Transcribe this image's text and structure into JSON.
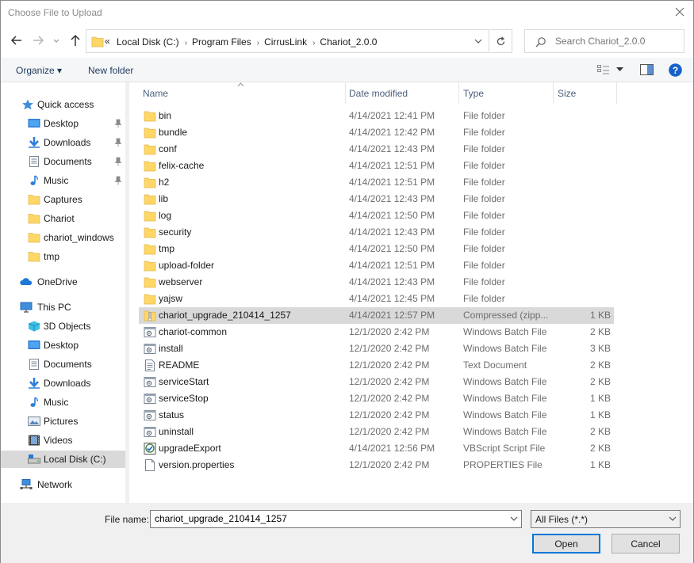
{
  "window": {
    "title": "Choose File to Upload"
  },
  "address": {
    "overflow": "«",
    "crumbs": [
      "Local Disk (C:)",
      "Program Files",
      "CirrusLink",
      "Chariot_2.0.0"
    ]
  },
  "search": {
    "placeholder": "Search Chariot_2.0.0"
  },
  "toolbar": {
    "organize": "Organize ▾",
    "new_folder": "New folder",
    "help": "?"
  },
  "nav": {
    "quick_access": "Quick access",
    "quick_items": [
      {
        "label": "Desktop",
        "icon": "desktop-icon",
        "pinned": true
      },
      {
        "label": "Downloads",
        "icon": "downloads-icon",
        "pinned": true
      },
      {
        "label": "Documents",
        "icon": "documents-icon",
        "pinned": true
      },
      {
        "label": "Music",
        "icon": "music-icon",
        "pinned": true
      },
      {
        "label": "Captures",
        "icon": "folder-icon",
        "pinned": false
      },
      {
        "label": "Chariot",
        "icon": "folder-icon",
        "pinned": false
      },
      {
        "label": "chariot_windows",
        "icon": "folder-icon",
        "pinned": false
      },
      {
        "label": "tmp",
        "icon": "folder-icon",
        "pinned": false
      }
    ],
    "onedrive": "OneDrive",
    "this_pc": "This PC",
    "pc_items": [
      {
        "label": "3D Objects",
        "icon": "3d-objects-icon"
      },
      {
        "label": "Desktop",
        "icon": "desktop-icon"
      },
      {
        "label": "Documents",
        "icon": "documents-icon"
      },
      {
        "label": "Downloads",
        "icon": "downloads-icon"
      },
      {
        "label": "Music",
        "icon": "music-icon"
      },
      {
        "label": "Pictures",
        "icon": "pictures-icon"
      },
      {
        "label": "Videos",
        "icon": "videos-icon"
      },
      {
        "label": "Local Disk (C:)",
        "icon": "drive-icon"
      }
    ],
    "network": "Network"
  },
  "columns": {
    "name": "Name",
    "date": "Date modified",
    "type": "Type",
    "size": "Size"
  },
  "files": [
    {
      "name": "bin",
      "date": "4/14/2021 12:41 PM",
      "type": "File folder",
      "size": "",
      "icon": "folder-icon"
    },
    {
      "name": "bundle",
      "date": "4/14/2021 12:42 PM",
      "type": "File folder",
      "size": "",
      "icon": "folder-icon"
    },
    {
      "name": "conf",
      "date": "4/14/2021 12:43 PM",
      "type": "File folder",
      "size": "",
      "icon": "folder-icon"
    },
    {
      "name": "felix-cache",
      "date": "4/14/2021 12:51 PM",
      "type": "File folder",
      "size": "",
      "icon": "folder-icon"
    },
    {
      "name": "h2",
      "date": "4/14/2021 12:51 PM",
      "type": "File folder",
      "size": "",
      "icon": "folder-icon"
    },
    {
      "name": "lib",
      "date": "4/14/2021 12:43 PM",
      "type": "File folder",
      "size": "",
      "icon": "folder-icon"
    },
    {
      "name": "log",
      "date": "4/14/2021 12:50 PM",
      "type": "File folder",
      "size": "",
      "icon": "folder-icon"
    },
    {
      "name": "security",
      "date": "4/14/2021 12:43 PM",
      "type": "File folder",
      "size": "",
      "icon": "folder-icon"
    },
    {
      "name": "tmp",
      "date": "4/14/2021 12:50 PM",
      "type": "File folder",
      "size": "",
      "icon": "folder-icon"
    },
    {
      "name": "upload-folder",
      "date": "4/14/2021 12:51 PM",
      "type": "File folder",
      "size": "",
      "icon": "folder-icon"
    },
    {
      "name": "webserver",
      "date": "4/14/2021 12:43 PM",
      "type": "File folder",
      "size": "",
      "icon": "folder-icon"
    },
    {
      "name": "yajsw",
      "date": "4/14/2021 12:45 PM",
      "type": "File folder",
      "size": "",
      "icon": "folder-icon"
    },
    {
      "name": "chariot_upgrade_210414_1257",
      "date": "4/14/2021 12:57 PM",
      "type": "Compressed (zipp...",
      "size": "1 KB",
      "icon": "zip-icon",
      "selected": true
    },
    {
      "name": "chariot-common",
      "date": "12/1/2020 2:42 PM",
      "type": "Windows Batch File",
      "size": "2 KB",
      "icon": "batch-file-icon"
    },
    {
      "name": "install",
      "date": "12/1/2020 2:42 PM",
      "type": "Windows Batch File",
      "size": "3 KB",
      "icon": "batch-file-icon"
    },
    {
      "name": "README",
      "date": "12/1/2020 2:42 PM",
      "type": "Text Document",
      "size": "2 KB",
      "icon": "text-file-icon"
    },
    {
      "name": "serviceStart",
      "date": "12/1/2020 2:42 PM",
      "type": "Windows Batch File",
      "size": "2 KB",
      "icon": "batch-file-icon"
    },
    {
      "name": "serviceStop",
      "date": "12/1/2020 2:42 PM",
      "type": "Windows Batch File",
      "size": "1 KB",
      "icon": "batch-file-icon"
    },
    {
      "name": "status",
      "date": "12/1/2020 2:42 PM",
      "type": "Windows Batch File",
      "size": "1 KB",
      "icon": "batch-file-icon"
    },
    {
      "name": "uninstall",
      "date": "12/1/2020 2:42 PM",
      "type": "Windows Batch File",
      "size": "2 KB",
      "icon": "batch-file-icon"
    },
    {
      "name": "upgradeExport",
      "date": "4/14/2021 12:56 PM",
      "type": "VBScript Script File",
      "size": "2 KB",
      "icon": "vbscript-icon"
    },
    {
      "name": "version.properties",
      "date": "12/1/2020 2:42 PM",
      "type": "PROPERTIES File",
      "size": "1 KB",
      "icon": "blank-file-icon"
    }
  ],
  "bottom": {
    "file_name_label": "File name:",
    "file_name_value": "chariot_upgrade_210414_1257",
    "file_type": "All Files (*.*)",
    "open": "Open",
    "cancel": "Cancel"
  },
  "colors": {
    "accent": "#0078d7",
    "folder": "#ffd766",
    "selection": "#d9d9d9",
    "header_text": "#4c607a"
  }
}
